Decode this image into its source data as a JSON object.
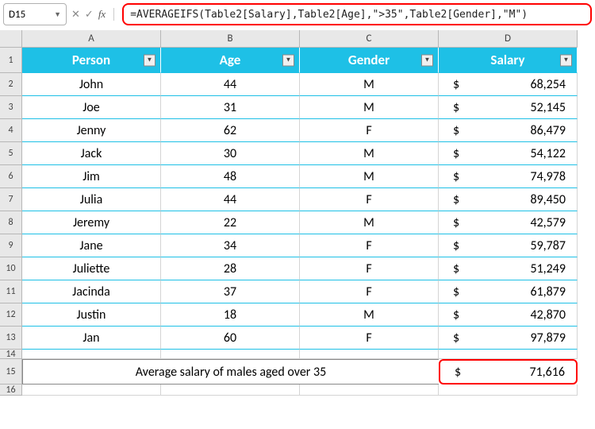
{
  "namebox": {
    "value": "D15"
  },
  "formula": {
    "text": "=AVERAGEIFS(Table2[Salary],Table2[Age],\">35\",Table2[Gender],\"M\")"
  },
  "columns": [
    "A",
    "B",
    "C",
    "D"
  ],
  "row_numbers": [
    "1",
    "2",
    "3",
    "4",
    "5",
    "6",
    "7",
    "8",
    "9",
    "10",
    "11",
    "12",
    "13",
    "14",
    "15",
    "16"
  ],
  "table": {
    "headers": {
      "person": "Person",
      "age": "Age",
      "gender": "Gender",
      "salary": "Salary"
    },
    "currency": "$",
    "rows": [
      {
        "person": "John",
        "age": "44",
        "gender": "M",
        "salary": "68,254"
      },
      {
        "person": "Joe",
        "age": "31",
        "gender": "M",
        "salary": "52,145"
      },
      {
        "person": "Jenny",
        "age": "62",
        "gender": "F",
        "salary": "86,479"
      },
      {
        "person": "Jack",
        "age": "30",
        "gender": "M",
        "salary": "54,122"
      },
      {
        "person": "Jim",
        "age": "48",
        "gender": "M",
        "salary": "74,978"
      },
      {
        "person": "Julia",
        "age": "44",
        "gender": "F",
        "salary": "89,450"
      },
      {
        "person": "Jeremy",
        "age": "22",
        "gender": "M",
        "salary": "42,579"
      },
      {
        "person": "Jane",
        "age": "34",
        "gender": "F",
        "salary": "59,787"
      },
      {
        "person": "Juliette",
        "age": "28",
        "gender": "F",
        "salary": "51,249"
      },
      {
        "person": "Jacinda",
        "age": "37",
        "gender": "F",
        "salary": "61,879"
      },
      {
        "person": "Justin",
        "age": "18",
        "gender": "M",
        "salary": "42,870"
      },
      {
        "person": "Jan",
        "age": "60",
        "gender": "F",
        "salary": "97,879"
      }
    ]
  },
  "summary": {
    "label": "Average salary of males aged over 35",
    "currency": "$",
    "value": "71,616"
  },
  "highlight_color": "#ff0000",
  "table_header_color": "#1ec0e6"
}
